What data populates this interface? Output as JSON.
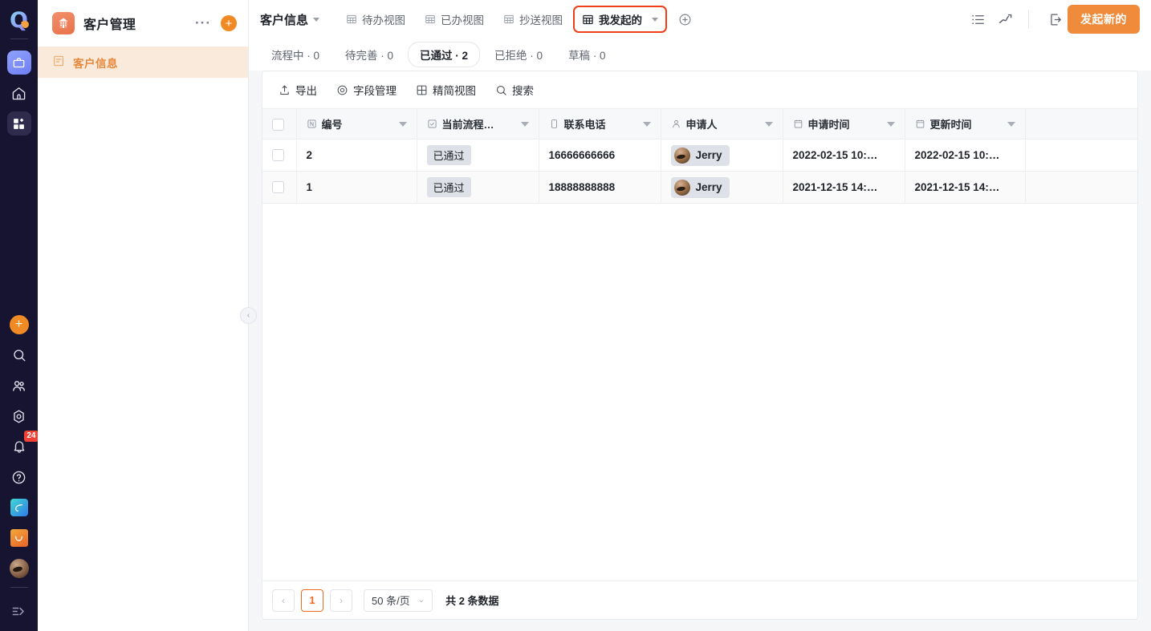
{
  "rail": {
    "logo": "q-logo",
    "icons": [
      {
        "name": "briefcase-icon"
      },
      {
        "name": "home-icon"
      },
      {
        "name": "apps-grid-icon"
      }
    ],
    "bottom_icons": [
      {
        "name": "add-icon"
      },
      {
        "name": "search-icon"
      },
      {
        "name": "contacts-icon"
      },
      {
        "name": "settings-icon"
      },
      {
        "name": "bell-icon",
        "badge": "24"
      },
      {
        "name": "help-icon"
      },
      {
        "name": "brand-leaf-icon"
      },
      {
        "name": "brand-mail-icon"
      },
      {
        "name": "user-avatar"
      },
      {
        "name": "expand-rail-icon"
      }
    ],
    "badge_count": "24"
  },
  "panel": {
    "app_title": "客户管理",
    "app_icon": "building-icon",
    "more_label": "···",
    "add_label": "+",
    "items": [
      {
        "label": "客户信息",
        "icon": "form-icon",
        "active": true
      }
    ],
    "collapse_label": "‹"
  },
  "topbar": {
    "form_name": "客户信息",
    "views": [
      {
        "label": "待办视图",
        "icon": "table-icon",
        "active": false
      },
      {
        "label": "已办视图",
        "icon": "table-icon",
        "active": false
      },
      {
        "label": "抄送视图",
        "icon": "table-icon",
        "active": false
      },
      {
        "label": "我发起的",
        "icon": "table-icon",
        "active": true
      }
    ],
    "add_view_label": "add-view-icon",
    "right_icons": [
      {
        "name": "list-view-icon"
      },
      {
        "name": "trend-chart-icon"
      },
      {
        "name": "logout-icon"
      }
    ],
    "primary_button": "发起新的"
  },
  "status_tabs": [
    {
      "label": "流程中 · 0",
      "active": false
    },
    {
      "label": "待完善 · 0",
      "active": false
    },
    {
      "label": "已通过 · 2",
      "active": true
    },
    {
      "label": "已拒绝 · 0",
      "active": false
    },
    {
      "label": "草稿 · 0",
      "active": false
    }
  ],
  "toolbar": [
    {
      "label": "导出",
      "icon": "export-icon"
    },
    {
      "label": "字段管理",
      "icon": "field-manage-icon"
    },
    {
      "label": "精简视图",
      "icon": "compact-view-icon"
    },
    {
      "label": "搜索",
      "icon": "search-icon"
    }
  ],
  "table": {
    "columns": [
      {
        "label": "编号",
        "icon": "number-icon"
      },
      {
        "label": "当前流程…",
        "icon": "checkbox-icon"
      },
      {
        "label": "联系电话",
        "icon": "phone-icon"
      },
      {
        "label": "申请人",
        "icon": "person-icon"
      },
      {
        "label": "申请时间",
        "icon": "calendar-icon"
      },
      {
        "label": "更新时间",
        "icon": "calendar-icon"
      }
    ],
    "rows": [
      {
        "id": "2",
        "status": "已通过",
        "phone": "16666666666",
        "applicant": "Jerry",
        "apply_time": "2022-02-15 10:…",
        "update_time": "2022-02-15 10:…"
      },
      {
        "id": "1",
        "status": "已通过",
        "phone": "18888888888",
        "applicant": "Jerry",
        "apply_time": "2021-12-15 14:…",
        "update_time": "2021-12-15 14:…"
      }
    ]
  },
  "pagination": {
    "prev": "‹",
    "current_page": "1",
    "next": "›",
    "page_size": "50 条/页",
    "total": "共 2 条数据"
  },
  "colors": {
    "accent_orange": "#ef8b3a",
    "highlight_red": "#f03e19",
    "rail_bg": "#161430",
    "panel_active_bg": "#faeadb",
    "panel_active_fg": "#e8883a"
  }
}
